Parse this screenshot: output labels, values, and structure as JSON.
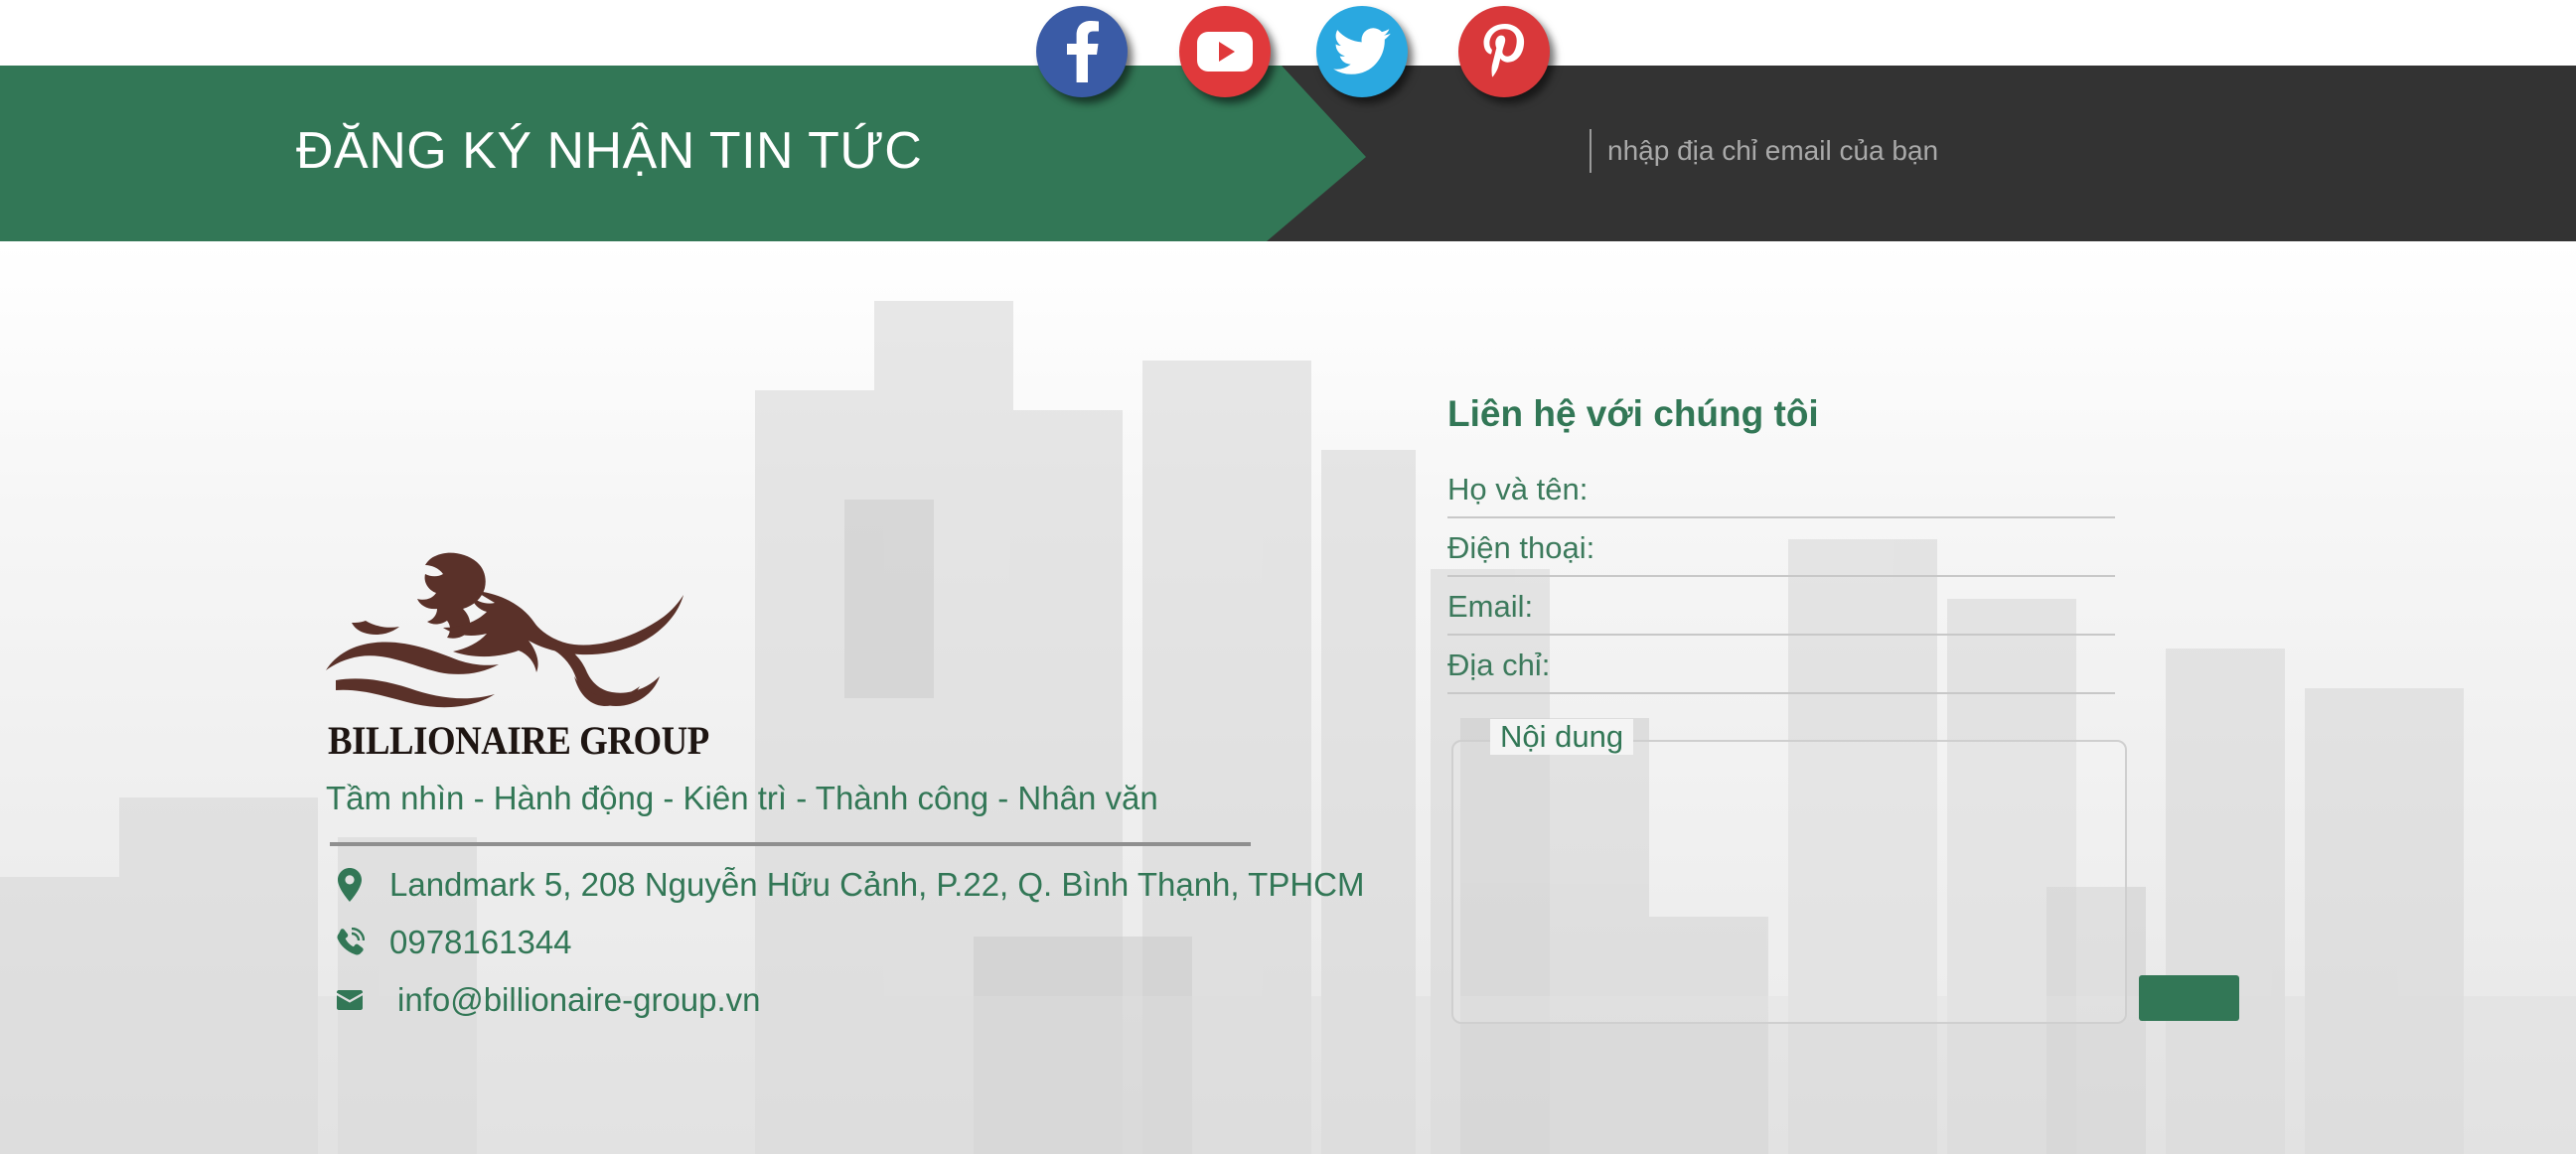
{
  "newsletter": {
    "title": "ĐĂNG KÝ NHẬN TIN TỨC",
    "email_placeholder": "nhập địa chỉ email của bạn"
  },
  "social": [
    {
      "icon": "facebook-icon",
      "color": "#3a5ba6"
    },
    {
      "icon": "youtube-icon",
      "color": "#e0393b"
    },
    {
      "icon": "twitter-icon",
      "color": "#2aa8e0"
    },
    {
      "icon": "pinterest-icon",
      "color": "#d9383a"
    }
  ],
  "company": {
    "logo_icon": "lion-logo-icon",
    "name": "BILLIONAIRE GROUP",
    "slogan": "Tầm nhìn - Hành động - Kiên trì - Thành công - Nhân văn",
    "address": "Landmark 5, 208 Nguyễn Hữu Cảnh, P.22, Q. Bình Thạnh, TPHCM",
    "phone": "0978161344",
    "email": "info@billionaire-group.vn"
  },
  "contact_form": {
    "title": "Liên hệ với chúng tôi",
    "name_placeholder": "Họ và tên:",
    "phone_placeholder": "Điện thoại:",
    "email_placeholder": "Email:",
    "address_placeholder": "Địa chỉ:",
    "message_label": "Nội dung",
    "submit_label": ""
  },
  "colors": {
    "brand_green": "#327756",
    "banner_dark": "#333333",
    "logo_brown": "#5a3129"
  }
}
